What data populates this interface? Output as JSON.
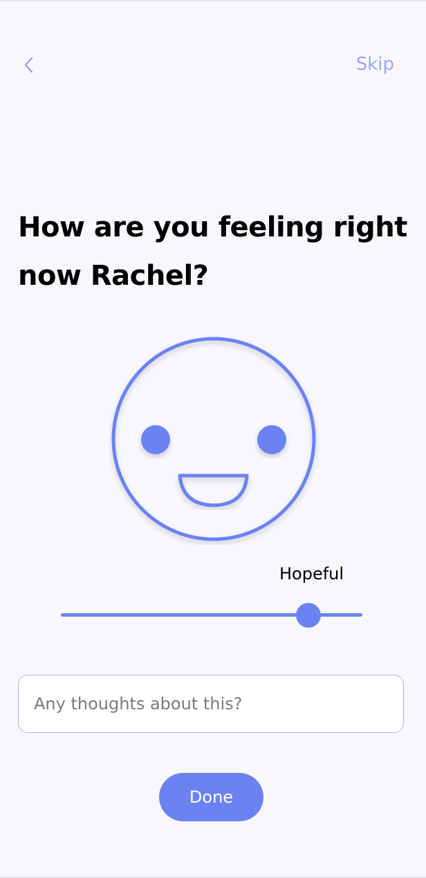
{
  "header": {
    "back_icon": "chevron-left-icon",
    "skip_label": "Skip"
  },
  "prompt": {
    "title": "How are you feeling right now Rachel?"
  },
  "mood": {
    "face_icon": "smiling-face-icon",
    "label": "Hopeful",
    "slider_value": 0.82
  },
  "thoughts": {
    "value": "",
    "placeholder": "Any thoughts about this?"
  },
  "actions": {
    "done_label": "Done"
  },
  "colors": {
    "accent": "#6b82f2",
    "skip_text": "#9aa7f0",
    "background": "#f8f7fd",
    "input_border": "#a8b4ee"
  }
}
